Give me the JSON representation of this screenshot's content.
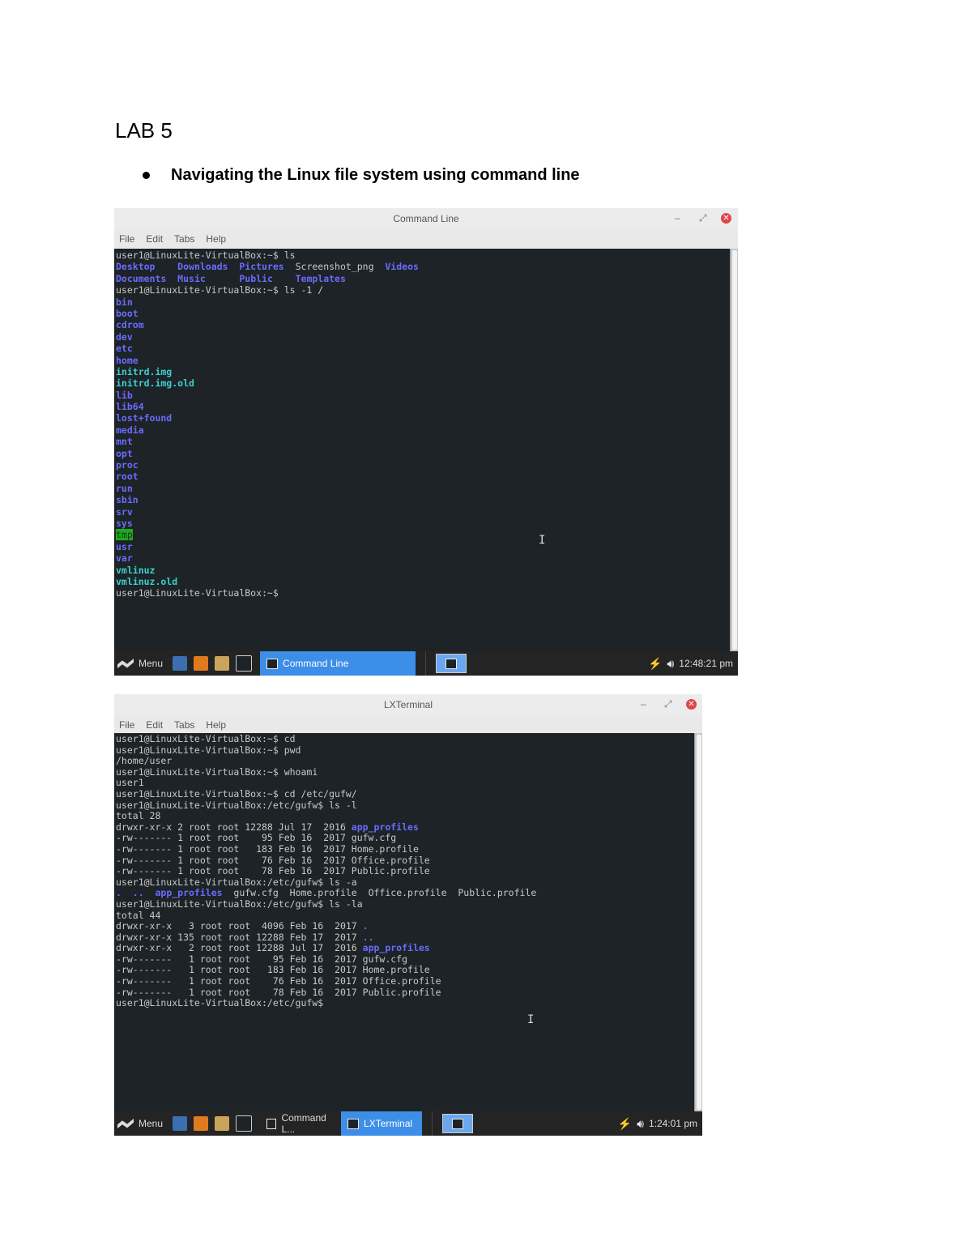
{
  "doc": {
    "title": "LAB 5",
    "bullet": "Navigating the Linux file system using command line"
  },
  "window1": {
    "title": "Command Line",
    "menu": [
      "File",
      "Edit",
      "Tabs",
      "Help"
    ],
    "lines": [
      [
        {
          "t": "user1@LinuxLite-VirtualBox:~$ ls"
        }
      ],
      [
        {
          "t": "Desktop    ",
          "c": "dir"
        },
        {
          "t": "Downloads  ",
          "c": "dir"
        },
        {
          "t": "Pictures  ",
          "c": "dir"
        },
        {
          "t": "Screenshot_png  "
        },
        {
          "t": "Videos",
          "c": "dir"
        }
      ],
      [
        {
          "t": "Documents  ",
          "c": "dir"
        },
        {
          "t": "Music      ",
          "c": "dir"
        },
        {
          "t": "Public    ",
          "c": "dir"
        },
        {
          "t": "Templates",
          "c": "dir"
        }
      ],
      [
        {
          "t": "user1@LinuxLite-VirtualBox:~$ ls -1 /"
        }
      ],
      [
        {
          "t": "bin",
          "c": "dir"
        }
      ],
      [
        {
          "t": "boot",
          "c": "dir"
        }
      ],
      [
        {
          "t": "cdrom",
          "c": "dir"
        }
      ],
      [
        {
          "t": "dev",
          "c": "dir"
        }
      ],
      [
        {
          "t": "etc",
          "c": "dir"
        }
      ],
      [
        {
          "t": "home",
          "c": "dir"
        }
      ],
      [
        {
          "t": "initrd.img",
          "c": "lnk"
        }
      ],
      [
        {
          "t": "initrd.img.old",
          "c": "lnk"
        }
      ],
      [
        {
          "t": "lib",
          "c": "dir"
        }
      ],
      [
        {
          "t": "lib64",
          "c": "dir"
        }
      ],
      [
        {
          "t": "lost+found",
          "c": "dir"
        }
      ],
      [
        {
          "t": "media",
          "c": "dir"
        }
      ],
      [
        {
          "t": "mnt",
          "c": "dir"
        }
      ],
      [
        {
          "t": "opt",
          "c": "dir"
        }
      ],
      [
        {
          "t": "proc",
          "c": "dir"
        }
      ],
      [
        {
          "t": "root",
          "c": "dir"
        }
      ],
      [
        {
          "t": "run",
          "c": "dir"
        }
      ],
      [
        {
          "t": "sbin",
          "c": "dir"
        }
      ],
      [
        {
          "t": "srv",
          "c": "dir"
        }
      ],
      [
        {
          "t": "sys",
          "c": "dir"
        }
      ],
      [
        {
          "t": "tmp",
          "c": "hl"
        }
      ],
      [
        {
          "t": "usr",
          "c": "dir"
        }
      ],
      [
        {
          "t": "var",
          "c": "dir"
        }
      ],
      [
        {
          "t": "vmlinuz",
          "c": "lnk"
        }
      ],
      [
        {
          "t": "vmlinuz.old",
          "c": "lnk"
        }
      ],
      [
        {
          "t": "user1@LinuxLite-VirtualBox:~$"
        }
      ]
    ],
    "taskbar": {
      "menu_label": "Menu",
      "task_label": "Command Line",
      "clock": "12:48:21 pm"
    }
  },
  "window2": {
    "title": "LXTerminal",
    "menu": [
      "File",
      "Edit",
      "Tabs",
      "Help"
    ],
    "lines": [
      [
        {
          "t": "user1@LinuxLite-VirtualBox:~$ cd"
        }
      ],
      [
        {
          "t": "user1@LinuxLite-VirtualBox:~$ pwd"
        }
      ],
      [
        {
          "t": "/home/user"
        }
      ],
      [
        {
          "t": "user1@LinuxLite-VirtualBox:~$ whoami"
        }
      ],
      [
        {
          "t": "user1"
        }
      ],
      [
        {
          "t": "user1@LinuxLite-VirtualBox:~$ cd /etc/gufw/"
        }
      ],
      [
        {
          "t": "user1@LinuxLite-VirtualBox:/etc/gufw$ ls -l"
        }
      ],
      [
        {
          "t": "total 28"
        }
      ],
      [
        {
          "t": "drwxr-xr-x 2 root root 12288 Jul 17  2016 "
        },
        {
          "t": "app_profiles",
          "c": "dir"
        }
      ],
      [
        {
          "t": "-rw------- 1 root root    95 Feb 16  2017 gufw.cfg"
        }
      ],
      [
        {
          "t": "-rw------- 1 root root   183 Feb 16  2017 Home.profile"
        }
      ],
      [
        {
          "t": "-rw------- 1 root root    76 Feb 16  2017 Office.profile"
        }
      ],
      [
        {
          "t": "-rw------- 1 root root    78 Feb 16  2017 Public.profile"
        }
      ],
      [
        {
          "t": "user1@LinuxLite-VirtualBox:/etc/gufw$ ls -a"
        }
      ],
      [
        {
          "t": ".  ..  ",
          "c": "dir"
        },
        {
          "t": "app_profiles",
          "c": "dir"
        },
        {
          "t": "  gufw.cfg  Home.profile  Office.profile  Public.profile"
        }
      ],
      [
        {
          "t": "user1@LinuxLite-VirtualBox:/etc/gufw$ ls -la"
        }
      ],
      [
        {
          "t": "total 44"
        }
      ],
      [
        {
          "t": "drwxr-xr-x   3 root root  4096 Feb 16  2017 "
        },
        {
          "t": ".",
          "c": "dir"
        }
      ],
      [
        {
          "t": "drwxr-xr-x 135 root root 12288 Feb 17  2017 "
        },
        {
          "t": "..",
          "c": "dir"
        }
      ],
      [
        {
          "t": "drwxr-xr-x   2 root root 12288 Jul 17  2016 "
        },
        {
          "t": "app_profiles",
          "c": "dir"
        }
      ],
      [
        {
          "t": "-rw-------   1 root root    95 Feb 16  2017 gufw.cfg"
        }
      ],
      [
        {
          "t": "-rw-------   1 root root   183 Feb 16  2017 Home.profile"
        }
      ],
      [
        {
          "t": "-rw-------   1 root root    76 Feb 16  2017 Office.profile"
        }
      ],
      [
        {
          "t": "-rw-------   1 root root    78 Feb 16  2017 Public.profile"
        }
      ],
      [
        {
          "t": "user1@LinuxLite-VirtualBox:/etc/gufw$"
        }
      ]
    ],
    "taskbar": {
      "menu_label": "Menu",
      "task1_label": "Command L...",
      "task2_label": "LXTerminal",
      "clock": "1:24:01 pm"
    }
  },
  "colors": {
    "terminal_bg": "#1d2326",
    "directory": "#6b6bff",
    "symlink": "#3ed0d0",
    "tmp_highlight": "#1faa1f",
    "taskbar_active": "#3d8ee8"
  }
}
